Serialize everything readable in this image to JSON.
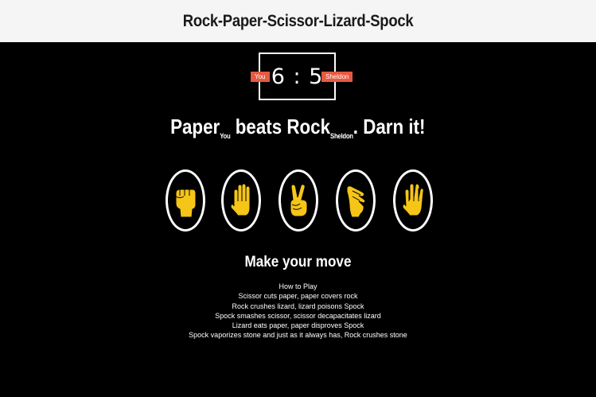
{
  "header": {
    "title": "Rock-Paper-Scissor-Lizard-Spock"
  },
  "score": {
    "you_label": "You",
    "sheldon_label": "Sheldon",
    "display": "6 : 5"
  },
  "result": {
    "player_move": "Paper",
    "player_tag": "You",
    "verb": "beats",
    "opponent_move": "Rock",
    "opponent_tag": "Sheldon",
    "tail": ". Darn it!"
  },
  "moves": [
    {
      "name": "rock",
      "icon": "rock-hand-icon"
    },
    {
      "name": "paper",
      "icon": "paper-hand-icon"
    },
    {
      "name": "scissor",
      "icon": "scissor-hand-icon"
    },
    {
      "name": "lizard",
      "icon": "lizard-hand-icon"
    },
    {
      "name": "spock",
      "icon": "spock-hand-icon"
    }
  ],
  "colors": {
    "accent": "#e8593f",
    "hand": "#f5c518",
    "background": "#000000"
  },
  "prompt": "Make your move",
  "rules": {
    "title": "How to Play",
    "lines": [
      "Scissor cuts paper, paper covers rock",
      "Rock crushes lizard, lizard poisons Spock",
      "Spock smashes scissor, scissor decapacitates lizard",
      "Lizard eats paper, paper disproves Spock",
      "Spock vaporizes stone and just as it always has, Rock crushes stone"
    ]
  }
}
